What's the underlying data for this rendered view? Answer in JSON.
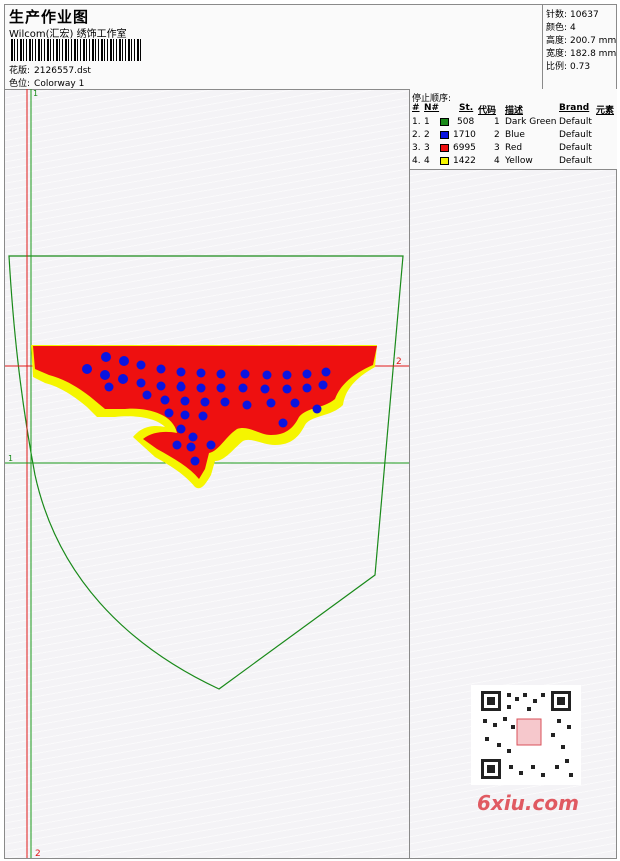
{
  "header": {
    "title": "生产作业图",
    "subtitle": "Wilcom(汇宏) 绣饰工作室",
    "design_label": "花版:",
    "design_value": "2126557.dst",
    "colorway_label": "色位:",
    "colorway_value": "Colorway 1"
  },
  "stats": {
    "stitches_label": "针数:",
    "stitches_value": "10637",
    "colors_label": "颜色:",
    "colors_value": "4",
    "height_label": "高度:",
    "height_value": "200.7 mm",
    "width_label": "宽度:",
    "width_value": "182.8 mm",
    "scale_label": "比例:",
    "scale_value": "0.73"
  },
  "stop_sequence": {
    "title": "停止顺序:",
    "columns": [
      "#",
      "N#",
      "St.",
      "代码",
      "描述",
      "Brand",
      "元素"
    ],
    "rows": [
      {
        "index": "1.",
        "n": "1",
        "color": "#1a8a1a",
        "stitches": "508",
        "code": "1",
        "description": "Dark Green",
        "brand": "Default"
      },
      {
        "index": "2.",
        "n": "2",
        "color": "#0a14e0",
        "stitches": "1710",
        "code": "2",
        "description": "Blue",
        "brand": "Default"
      },
      {
        "index": "3.",
        "n": "3",
        "color": "#ee1010",
        "stitches": "6995",
        "code": "3",
        "description": "Red",
        "brand": "Default"
      },
      {
        "index": "4.",
        "n": "4",
        "color": "#f5f500",
        "stitches": "1422",
        "code": "4",
        "description": "Yellow",
        "brand": "Default"
      }
    ]
  },
  "guides": {
    "v1_top": "1",
    "v1_bottom": "2",
    "h1_left": "1",
    "h2_right": "2"
  },
  "watermark": {
    "text": "6xiu.com",
    "accent": "#e05a62"
  }
}
